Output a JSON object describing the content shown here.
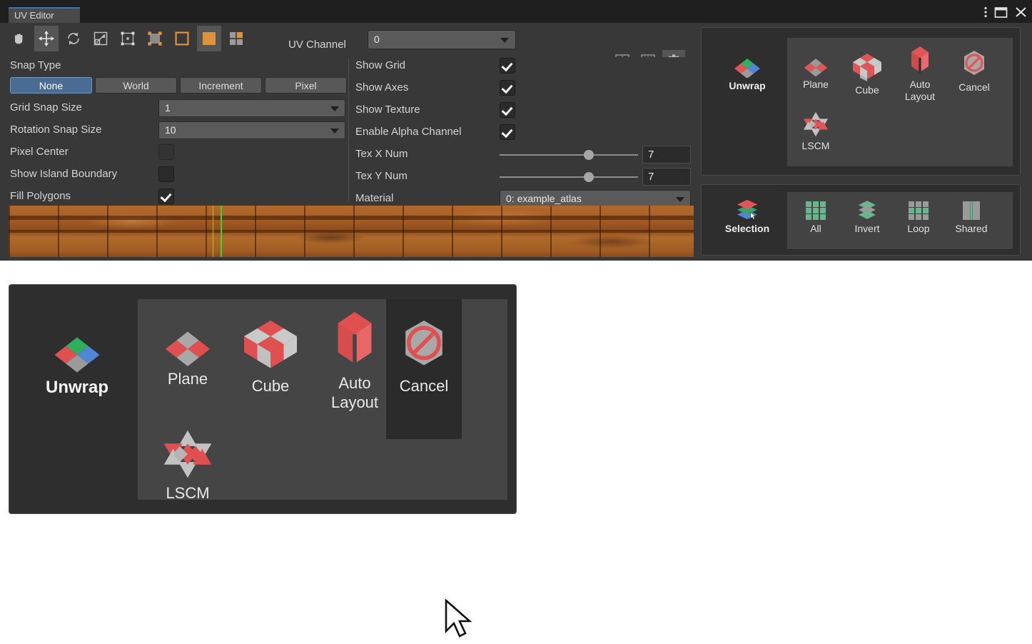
{
  "window": {
    "tab_label": "UV Editor",
    "title_controls": [
      {
        "name": "more-options",
        "glyph": "⋮"
      },
      {
        "name": "maximize",
        "glyph": "▣"
      },
      {
        "name": "close",
        "glyph": "✕"
      }
    ]
  },
  "toolbar": {
    "tools": [
      {
        "name": "hand-tool",
        "label": "Hand",
        "active": false
      },
      {
        "name": "move-tool",
        "label": "Move",
        "active": true
      },
      {
        "name": "rotate-tool",
        "label": "Rotate",
        "active": false
      },
      {
        "name": "scale-tool",
        "label": "Scale",
        "active": false
      },
      {
        "name": "transform-tool",
        "label": "Transform",
        "active": false
      },
      {
        "name": "vertex-select",
        "label": "Vertex",
        "active": false
      },
      {
        "name": "edge-select",
        "label": "Edge",
        "active": false
      },
      {
        "name": "face-select",
        "label": "Face",
        "active": true
      },
      {
        "name": "island-select",
        "label": "Island",
        "active": false
      }
    ],
    "uv_channel_label": "UV Channel",
    "uv_channel_value": "0",
    "right_tools": [
      {
        "name": "center-view",
        "label": "Center",
        "active": false
      },
      {
        "name": "grid-view",
        "label": "Grid",
        "active": false
      },
      {
        "name": "settings-gear",
        "label": "Settings",
        "active": true
      }
    ]
  },
  "settings": {
    "snap_type_label": "Snap Type",
    "snap_type_options": [
      "None",
      "World",
      "Increment",
      "Pixel"
    ],
    "snap_type_selected": "None",
    "grid_snap_size_label": "Grid Snap Size",
    "grid_snap_size_value": "1",
    "rotation_snap_size_label": "Rotation Snap Size",
    "rotation_snap_size_value": "10",
    "pixel_center_label": "Pixel Center",
    "pixel_center_checked": false,
    "pixel_center_disabled": true,
    "show_island_boundary_label": "Show Island Boundary",
    "show_island_boundary_checked": false,
    "fill_polygons_label": "Fill Polygons",
    "fill_polygons_checked": true,
    "show_grid_label": "Show Grid",
    "show_grid_checked": true,
    "show_axes_label": "Show Axes",
    "show_axes_checked": true,
    "show_texture_label": "Show Texture",
    "show_texture_checked": true,
    "enable_alpha_label": "Enable Alpha Channel",
    "enable_alpha_checked": true,
    "tex_x_num_label": "Tex X Num",
    "tex_x_num_value": "7",
    "tex_y_num_label": "Tex Y Num",
    "tex_y_num_value": "7",
    "material_label": "Material",
    "material_value": "0: example_atlas"
  },
  "unwrap_panel": {
    "head_label": "Unwrap",
    "head_icon": "diamond-rgb-icon",
    "items": [
      {
        "label": "Plane",
        "icon": "plane-diamond-icon"
      },
      {
        "label": "Cube",
        "icon": "cube-icon"
      },
      {
        "label": "Auto\nLayout",
        "label_line1": "Auto",
        "label_line2": "Layout",
        "icon": "auto-layout-cube-icon"
      },
      {
        "label": "Cancel",
        "icon": "cancel-hex-icon"
      },
      {
        "label": "LSCM",
        "icon": "lscm-star-icon"
      }
    ]
  },
  "selection_panel": {
    "head_label": "Selection",
    "head_icon": "selection-layers-icon",
    "items": [
      {
        "label": "All",
        "icon": "grid-all-icon"
      },
      {
        "label": "Invert",
        "icon": "invert-layers-icon"
      },
      {
        "label": "Loop",
        "icon": "grid-loop-icon"
      },
      {
        "label": "Shared",
        "icon": "shared-bars-icon"
      }
    ]
  },
  "zoom_panel": {
    "head_label": "Unwrap",
    "items": [
      {
        "label_line1": "Plane",
        "label_line2": "",
        "icon": "plane-diamond-icon",
        "hovered": false
      },
      {
        "label_line1": "Cube",
        "label_line2": "",
        "icon": "cube-icon",
        "hovered": false
      },
      {
        "label_line1": "Auto",
        "label_line2": "Layout",
        "icon": "auto-layout-cube-icon",
        "hovered": false
      },
      {
        "label_line1": "Cancel",
        "label_line2": "",
        "icon": "cancel-hex-icon",
        "hovered": true
      },
      {
        "label_line1": "LSCM",
        "label_line2": "",
        "icon": "lscm-star-icon",
        "hovered": false
      }
    ]
  },
  "colors": {
    "accent_orange": "#e0913c",
    "accent_blue": "#4a6c92",
    "icon_red": "#e05555",
    "icon_gray": "#b0b0b0",
    "icon_green": "#30b060",
    "selection_green": "#68b58e",
    "panel_bg": "#2e2e2e",
    "window_bg": "#383838",
    "texture_base": "#a75f26",
    "uv_marker_green": "#2ee02e"
  }
}
